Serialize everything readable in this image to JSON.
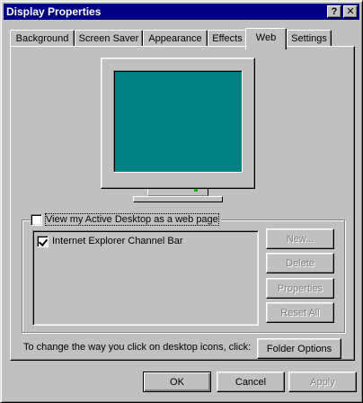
{
  "window": {
    "title": "Display Properties",
    "help_label": "?",
    "close_label": "✕"
  },
  "tabs": [
    {
      "label": "Background"
    },
    {
      "label": "Screen Saver"
    },
    {
      "label": "Appearance"
    },
    {
      "label": "Effects"
    },
    {
      "label": "Web"
    },
    {
      "label": "Settings"
    }
  ],
  "active_tab": "Web",
  "web": {
    "view_active_desktop": {
      "label": "View my Active Desktop as a web page",
      "checked": false
    },
    "items": [
      {
        "label": "Internet Explorer Channel Bar",
        "checked": true
      }
    ],
    "buttons": {
      "new": "New...",
      "delete": "Delete",
      "properties": "Properties",
      "reset_all": "Reset All"
    },
    "click_text": "To change the way you click on desktop icons, click:",
    "folder_options": "Folder Options"
  },
  "dialog_buttons": {
    "ok": "OK",
    "cancel": "Cancel",
    "apply": "Apply"
  },
  "colors": {
    "title_bar": "#000080",
    "desktop_preview": "#008080",
    "face": "#c0c0c0"
  }
}
